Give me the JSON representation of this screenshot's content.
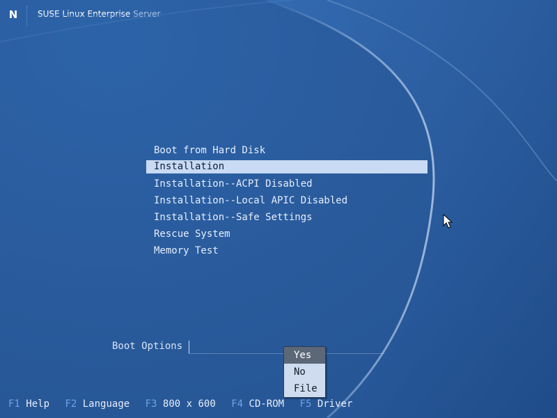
{
  "colors": {
    "background": "#2a5d9c",
    "menu_text": "#e6eefb",
    "selection_bg": "#c9daf4",
    "fkey_key": "#6fa2e8",
    "popup_bg": "#cfdcef",
    "popup_selected": "#5c6878"
  },
  "header": {
    "logo_letter": "N",
    "logo_icon": "novell-n-icon",
    "brand_primary": "SUSE Linux Enterprise",
    "brand_secondary": "Server"
  },
  "boot_menu": {
    "items": [
      {
        "label": "Boot from Hard Disk",
        "selected": false
      },
      {
        "label": "Installation",
        "selected": true
      },
      {
        "label": "Installation--ACPI Disabled",
        "selected": false
      },
      {
        "label": "Installation--Local APIC Disabled",
        "selected": false
      },
      {
        "label": "Installation--Safe Settings",
        "selected": false
      },
      {
        "label": "Rescue System",
        "selected": false
      },
      {
        "label": "Memory Test",
        "selected": false
      }
    ]
  },
  "boot_options": {
    "label": "Boot Options",
    "value": ""
  },
  "popup": {
    "items": [
      {
        "label": "Yes",
        "selected": true
      },
      {
        "label": "No",
        "selected": false
      },
      {
        "label": "File",
        "selected": false
      }
    ]
  },
  "function_keys": [
    {
      "key": "F1",
      "label": "Help"
    },
    {
      "key": "F2",
      "label": "Language"
    },
    {
      "key": "F3",
      "label": "800 x 600"
    },
    {
      "key": "F4",
      "label": "CD-ROM"
    },
    {
      "key": "F5",
      "label": "Driver"
    }
  ],
  "cursor": {
    "icon": "mouse-pointer-icon"
  }
}
